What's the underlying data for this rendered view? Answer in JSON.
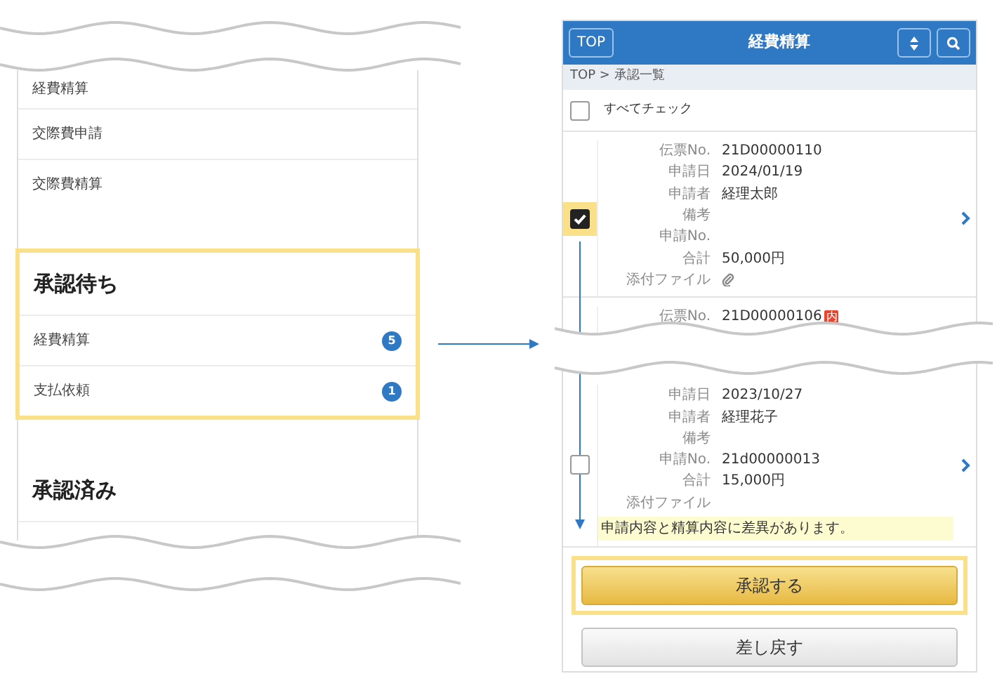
{
  "menu_panel": {
    "sections": [
      {
        "items": [
          {
            "label": "経費精算"
          },
          {
            "label": "交際費申請"
          },
          {
            "label": "交際費精算"
          }
        ]
      },
      {
        "heading": "承認待ち",
        "highlighted": true,
        "items": [
          {
            "label": "経費精算",
            "badge": "5"
          },
          {
            "label": "支払依頼",
            "badge": "1"
          }
        ]
      },
      {
        "heading": "承認済み",
        "highlighted": false
      }
    ]
  },
  "phone": {
    "header": {
      "top_button": "TOP",
      "title": "経費精算"
    },
    "breadcrumb": "TOP > 承認一覧",
    "check_all": {
      "label": "すべてチェック",
      "checked": false
    },
    "records": [
      {
        "checked": true,
        "highlighted": true,
        "chevron": true,
        "fields": [
          {
            "label": "伝票No.",
            "value": "21D00000110"
          },
          {
            "label": "申請日",
            "value": "2024/01/19"
          },
          {
            "label": "申請者",
            "value": "経理太郎"
          },
          {
            "label": "備考"
          },
          {
            "label": "申請No."
          },
          {
            "label": "合計",
            "value": "50,000円"
          },
          {
            "label": "添付ファイル",
            "kind": "attachment",
            "attached": true
          }
        ]
      },
      {
        "chevron": false,
        "fields": [
          {
            "label": "伝票No.",
            "value": "21D00000106",
            "tag": "内"
          }
        ]
      },
      {
        "checked": false,
        "chevron": true,
        "cut_top": true,
        "fields": [
          {
            "label": "申請日",
            "value": "2023/10/27"
          },
          {
            "label": "申請者",
            "value": "経理花子"
          },
          {
            "label": "備考"
          },
          {
            "label": "申請No.",
            "value": "21d00000013"
          },
          {
            "label": "合計",
            "value": "15,000円"
          },
          {
            "label": "添付ファイル",
            "kind": "attachment",
            "attached": false
          }
        ],
        "warning": "申請内容と精算内容に差異があります。"
      }
    ],
    "buttons": [
      {
        "label": "承認する",
        "kind": "primary",
        "highlighted": true
      },
      {
        "label": "差し戻す",
        "kind": "secondary",
        "highlighted": false
      }
    ]
  }
}
